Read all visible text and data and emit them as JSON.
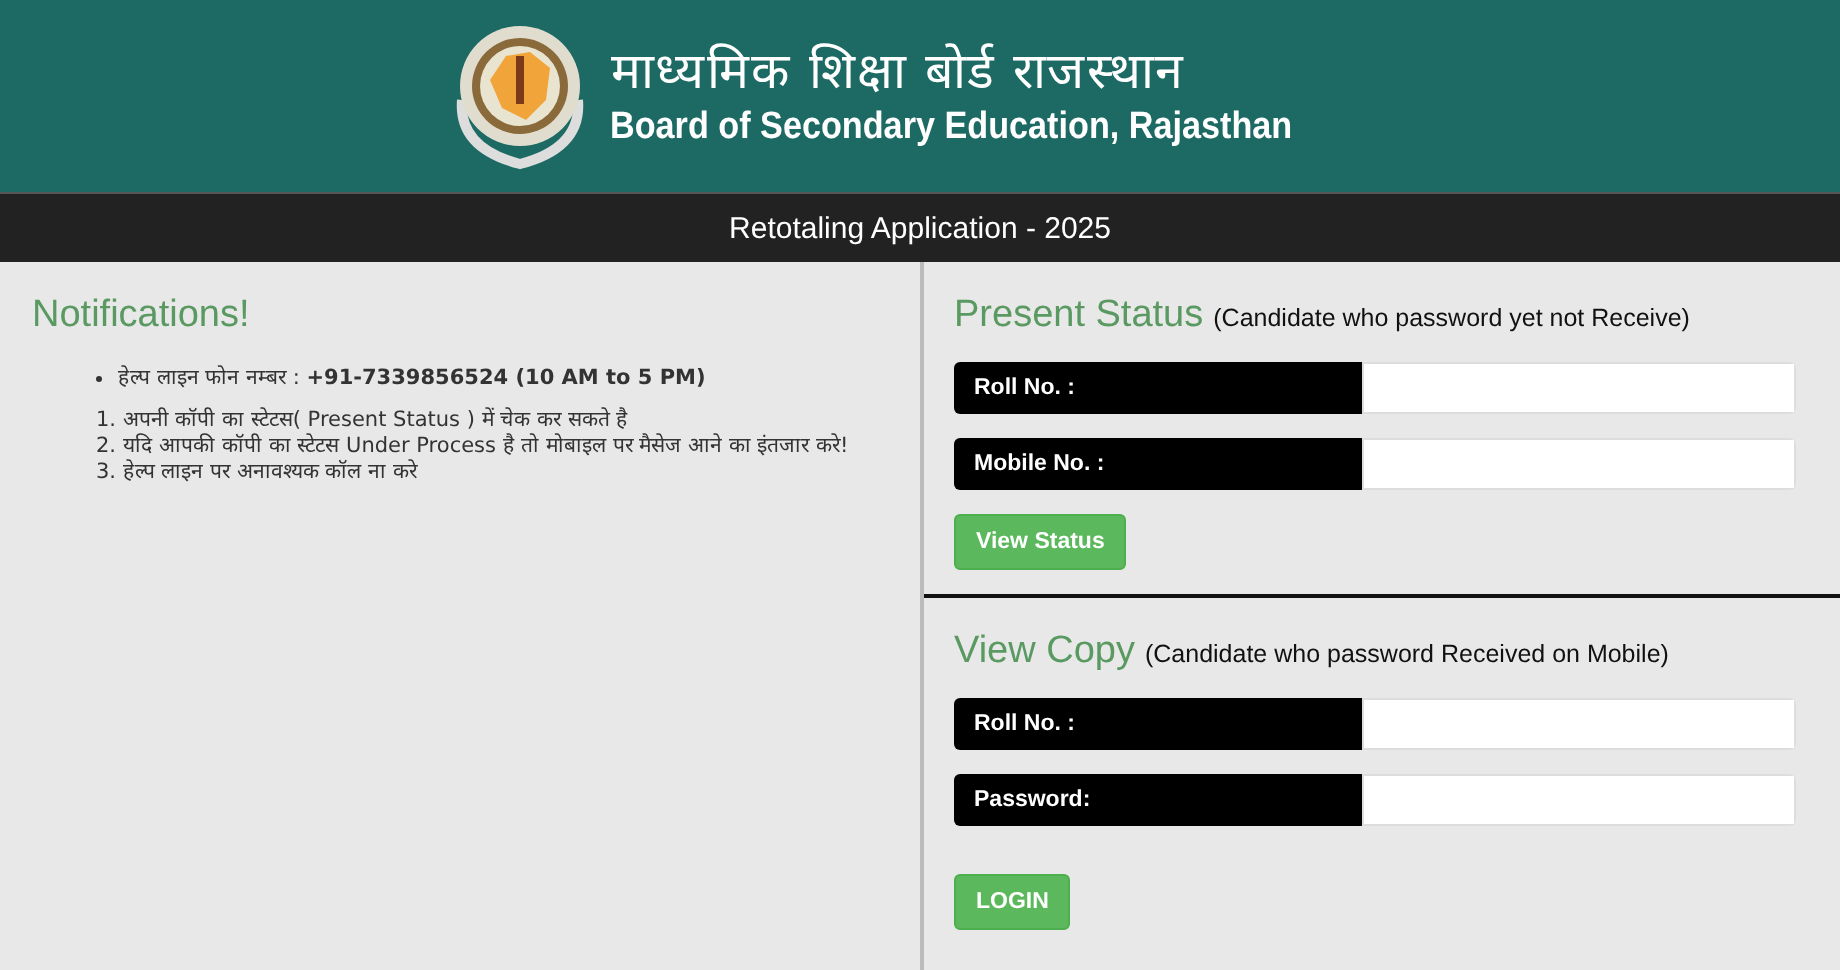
{
  "header": {
    "title_hindi": "माध्यमिक शिक्षा बोर्ड राजस्थान",
    "title_english": "Board of Secondary Education, Rajasthan"
  },
  "title_bar": {
    "title": "Retotaling Application - 2025"
  },
  "notifications": {
    "heading": "Notifications!",
    "bullets": [
      "हेल्प लाइन फोन नम्बर : **+91-7339856524 (10 AM to 5 PM)**"
    ],
    "numbered": [
      "1. अपनी कॉपी का स्टेटस( Present Status ) में चेक कर सकते है",
      "2. यदि आपकी कॉपी का स्टेटस Under Process है तो मोबाइल पर मैसेज आने का इंतजार करे!",
      "3. हेल्प लाइन पर अनावश्यक कॉल ना करे"
    ]
  },
  "forms": [
    {
      "heading": "Present Status",
      "subtitle": "(Candidate who password yet not Receive)",
      "fields": [
        {
          "label": "Roll No. :"
        },
        {
          "label": "Mobile No. :"
        }
      ],
      "button": "View Status"
    },
    {
      "heading": "View Copy",
      "subtitle": "(Candidate who password Received on Mobile)",
      "fields": [
        {
          "label": "Roll No. :"
        },
        {
          "label": "Password:"
        }
      ],
      "button": "LOGIN"
    }
  ]
}
